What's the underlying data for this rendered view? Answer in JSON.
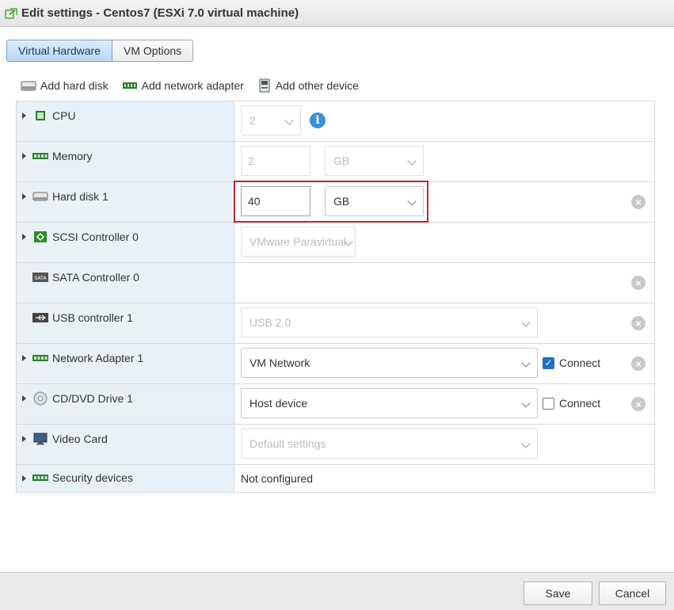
{
  "window": {
    "title": "Edit settings - Centos7 (ESXi 7.0 virtual machine)"
  },
  "tabs": [
    {
      "label": "Virtual Hardware",
      "active": true
    },
    {
      "label": "VM Options",
      "active": false
    }
  ],
  "toolbar": {
    "add_hard_disk": "Add hard disk",
    "add_network_adapter": "Add network adapter",
    "add_other_device": "Add other device"
  },
  "hardware": {
    "cpu": {
      "label": "CPU",
      "value": "2"
    },
    "memory": {
      "label": "Memory",
      "value": "2",
      "unit": "GB"
    },
    "hard_disk": {
      "label": "Hard disk 1",
      "value": "40",
      "unit": "GB"
    },
    "scsi": {
      "label": "SCSI Controller 0",
      "value": "VMware Paravirtual"
    },
    "sata": {
      "label": "SATA Controller 0"
    },
    "usb": {
      "label": "USB controller 1",
      "value": "USB 2.0"
    },
    "network": {
      "label": "Network Adapter 1",
      "value": "VM Network",
      "connect_label": "Connect",
      "connected": true
    },
    "cddvd": {
      "label": "CD/DVD Drive 1",
      "value": "Host device",
      "connect_label": "Connect",
      "connected": false
    },
    "video": {
      "label": "Video Card",
      "value": "Default settings"
    },
    "security": {
      "label": "Security devices",
      "value": "Not configured"
    }
  },
  "footer": {
    "save_label": "Save",
    "cancel_label": "Cancel"
  },
  "colors": {
    "accent": "#1f6fc8",
    "highlight": "#c0262d",
    "left_col_bg": "#e9f1f8"
  }
}
